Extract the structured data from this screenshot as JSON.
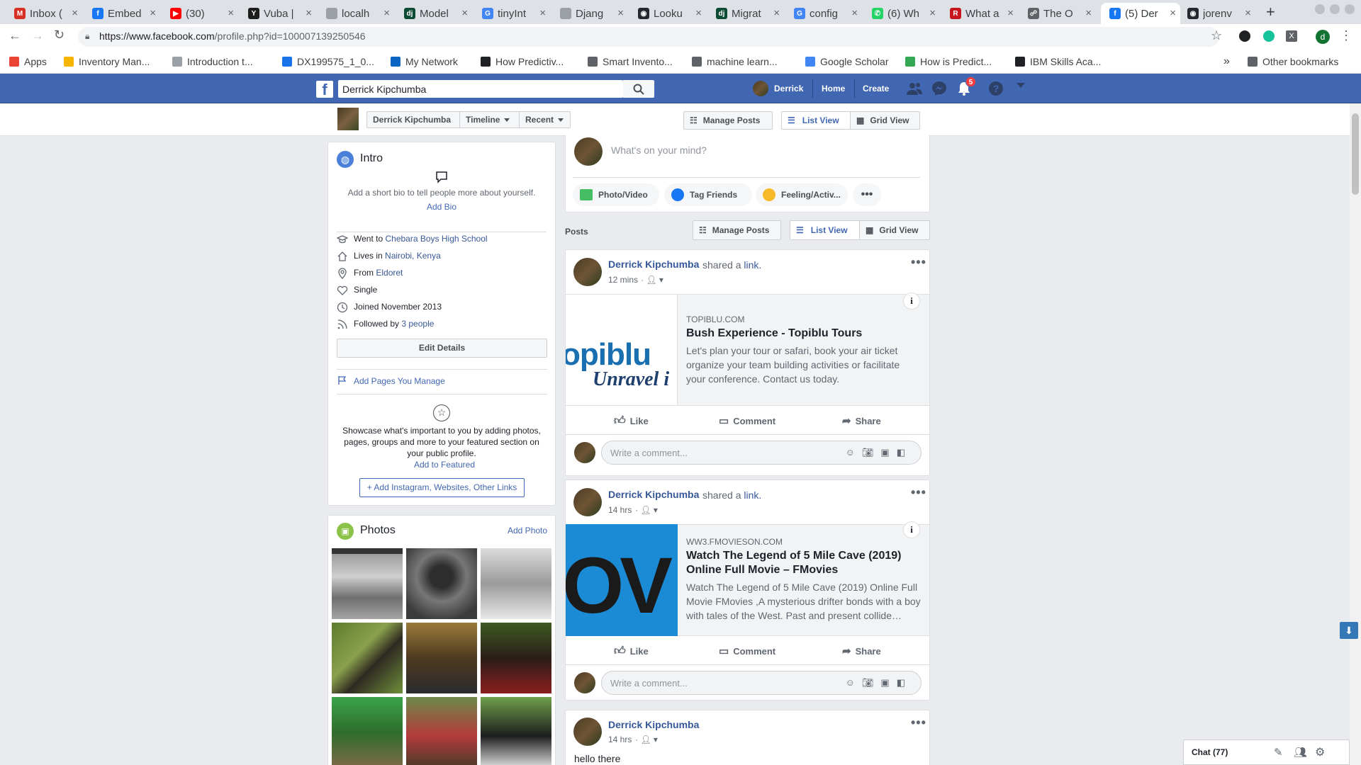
{
  "browser": {
    "tabs": [
      {
        "title": "Inbox (",
        "color": "#d93025",
        "glyph": "M"
      },
      {
        "title": "Embed",
        "color": "#1877f2",
        "glyph": "f"
      },
      {
        "title": "(30)",
        "color": "#ff0000",
        "glyph": "▶"
      },
      {
        "title": "Vuba |",
        "color": "#1d1d1d",
        "glyph": "Y"
      },
      {
        "title": "localh",
        "color": "#9aa0a6",
        "glyph": ""
      },
      {
        "title": "Model",
        "color": "#0c4b33",
        "glyph": "dj"
      },
      {
        "title": "tinyInt",
        "color": "#4285f4",
        "glyph": "G"
      },
      {
        "title": "Djang",
        "color": "#9aa0a6",
        "glyph": ""
      },
      {
        "title": "Looku",
        "color": "#24292e",
        "glyph": "◉"
      },
      {
        "title": "Migrat",
        "color": "#0c4b33",
        "glyph": "dj"
      },
      {
        "title": "config",
        "color": "#4285f4",
        "glyph": "G"
      },
      {
        "title": "(6) Wh",
        "color": "#25d366",
        "glyph": "✆"
      },
      {
        "title": "What a",
        "color": "#c4161c",
        "glyph": "R"
      },
      {
        "title": "The O",
        "color": "#5f6368",
        "glyph": "☍"
      },
      {
        "title": "(5) Der",
        "color": "#1877f2",
        "glyph": "f"
      },
      {
        "title": "jorenv",
        "color": "#24292e",
        "glyph": "◉"
      }
    ],
    "url_host": "https://www.facebook.com",
    "url_path": "/profile.php?id=100007139250546",
    "bookmarks": [
      {
        "label": "Apps",
        "color": "#ea4335"
      },
      {
        "label": "Inventory Man...",
        "color": "#f4b400"
      },
      {
        "label": "Introduction t...",
        "color": "#9aa0a6"
      },
      {
        "label": "DX199575_1_0...",
        "color": "#1a73e8"
      },
      {
        "label": "My Network",
        "color": "#0a66c2"
      },
      {
        "label": "How Predictiv...",
        "color": "#202124"
      },
      {
        "label": "Smart Invento...",
        "color": "#5f6368"
      },
      {
        "label": "machine learn...",
        "color": "#5f6368"
      },
      {
        "label": "Google Scholar",
        "color": "#4285f4"
      },
      {
        "label": "How is Predict...",
        "color": "#34a853"
      },
      {
        "label": "IBM Skills Aca...",
        "color": "#202124"
      }
    ],
    "other_bookmarks": "Other bookmarks",
    "more_bookmarks": "»"
  },
  "fb": {
    "search_value": "Derrick Kipchumba",
    "nav_name": "Derrick",
    "nav_home": "Home",
    "nav_create": "Create",
    "notif_count": "5",
    "brand_color": "#4267b2"
  },
  "profile_header": {
    "name": "Derrick Kipchumba",
    "timeline": "Timeline",
    "recent": "Recent",
    "manage_posts": "Manage Posts",
    "list_view": "List View",
    "grid_view": "Grid View"
  },
  "intro": {
    "title": "Intro",
    "bio_prompt": "Add a short bio to tell people more about yourself.",
    "add_bio": "Add Bio",
    "went_to_prefix": "Went to",
    "went_to": "Chebara Boys High School",
    "lives_prefix": "Lives in",
    "lives": "Nairobi, Kenya",
    "from_prefix": "From",
    "from": "Eldoret",
    "relationship": "Single",
    "joined": "Joined November 2013",
    "followed_prefix": "Followed by",
    "followed": "3 people",
    "edit_details": "Edit Details",
    "add_pages": "Add Pages You Manage",
    "featured_text": "Showcase what's important to you by adding photos, pages, groups and more to your featured section on your public profile.",
    "add_featured": "Add to Featured",
    "add_links": "Add Instagram, Websites, Other Links"
  },
  "photos": {
    "title": "Photos",
    "add_photo": "Add Photo"
  },
  "composer": {
    "placeholder": "What's on your mind?",
    "photo_video": "Photo/Video",
    "tag_friends": "Tag Friends",
    "feeling": "Feeling/Activ..."
  },
  "posts_bar": {
    "label": "Posts",
    "manage_posts": "Manage Posts",
    "list_view": "List View",
    "grid_view": "Grid View"
  },
  "posts": [
    {
      "author": "Derrick Kipchumba",
      "action": "shared a",
      "action_link": "link.",
      "time": "12 mins",
      "domain": "TOPIBLU.COM",
      "title": "Bush Experience - Topiblu Tours",
      "desc": "Let's plan your tour or safari, book your air ticket organize your team building activities or facilitate your conference. Contact us today.",
      "thumb_text": "opiblu",
      "thumb_sub": "Unravel i"
    },
    {
      "author": "Derrick Kipchumba",
      "action": "shared a",
      "action_link": "link.",
      "time": "14 hrs",
      "domain": "WW3.FMOVIESON.COM",
      "title": "Watch The Legend of 5 Mile Cave (2019) Online Full Movie – FMovies",
      "desc": "Watch The Legend of 5 Mile Cave (2019) Online Full Movie FMovies ,A mysterious drifter bonds with a boy with tales of the West. Past and present collide…",
      "thumb_text": "IOV"
    },
    {
      "author": "Derrick Kipchumba",
      "time": "14 hrs",
      "text": "hello there"
    }
  ],
  "actions": {
    "like": "Like",
    "comment": "Comment",
    "share": "Share",
    "comment_placeholder": "Write a comment..."
  },
  "chat": {
    "label": "Chat (77)"
  }
}
